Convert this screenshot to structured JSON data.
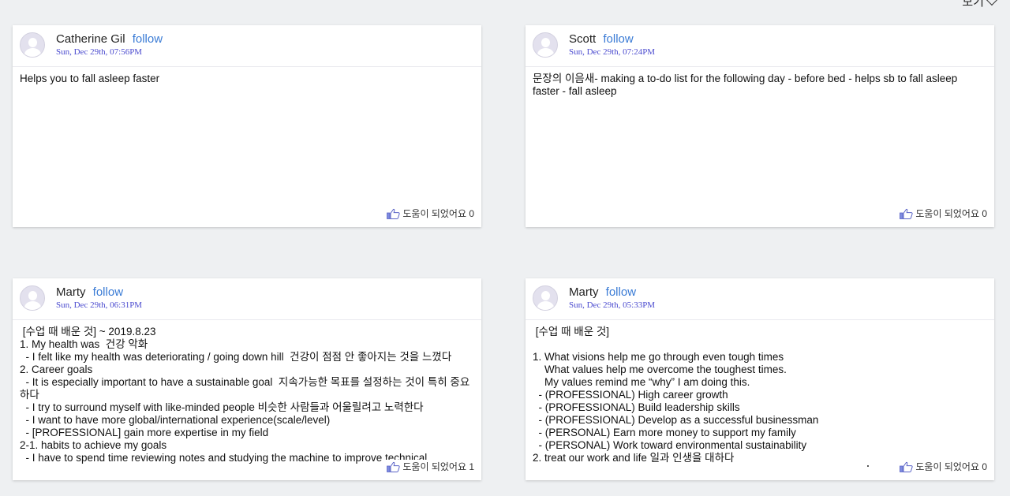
{
  "header": {
    "view_label": "보기"
  },
  "posts": [
    {
      "author": "Catherine Gil",
      "follow": "follow",
      "timestamp": "Sun, Dec 29th, 07:56PM",
      "body": "Helps you to fall asleep faster",
      "helpful": "도움이 되었어요 0"
    },
    {
      "author": "Scott",
      "follow": "follow",
      "timestamp": "Sun, Dec 29th, 07:24PM",
      "body": "문장의 이음새- making a to-do list for the following day - before bed - helps sb to fall asleep faster - fall asleep",
      "helpful": "도움이 되었어요 0"
    },
    {
      "author": "Marty",
      "follow": "follow",
      "timestamp": "Sun, Dec 29th, 06:31PM",
      "body": " [수업 때 배운 것] ~ 2019.8.23\n1. My health was  건강 악화\n  - I felt like my health was deteriorating / going down hill  건강이 점점 안 좋아지는 것을 느꼈다\n2. Career goals\n  - It is especially important to have a sustainable goal  지속가능한 목표를 설정하는 것이 특히 중요하다\n  - I try to surround myself with like-minded people 비슷한 사람들과 어울릴려고 노력한다\n  - I want to have more global/international experience(scale/level)\n  - [PROFESSIONAL] gain more expertise in my field\n2-1. habits to achieve my goals\n  - I have to spend time reviewing notes and studying the machine to improve technical",
      "helpful": "도움이 되었어요 1"
    },
    {
      "author": "Marty",
      "follow": "follow",
      "timestamp": "Sun, Dec 29th, 05:33PM",
      "body": " [수업 때 배운 것]\n\n1. What visions help me go through even tough times\n    What values help me overcome the toughest times.\n    My values remind me “why” I am doing this.\n  - (PROFESSIONAL) High career growth\n  - (PROFESSIONAL) Build leadership skills\n  - (PROFESSIONAL) Develop as a successful businessman\n  - (PERSONAL) Earn more money to support my family\n  - (PERSONAL) Work toward environmental sustainability\n2. treat our work and life 일과 인생을 대하다",
      "helpful": "도움이 되었어요 0"
    }
  ],
  "icons": {
    "avatar": "user-avatar-icon",
    "like": "thumbs-up-icon",
    "dropdown": "chevron-down-icon"
  },
  "colors": {
    "follow": "#3a7bd5",
    "timestamp": "#4b4bcf",
    "background": "#eef0f2"
  }
}
